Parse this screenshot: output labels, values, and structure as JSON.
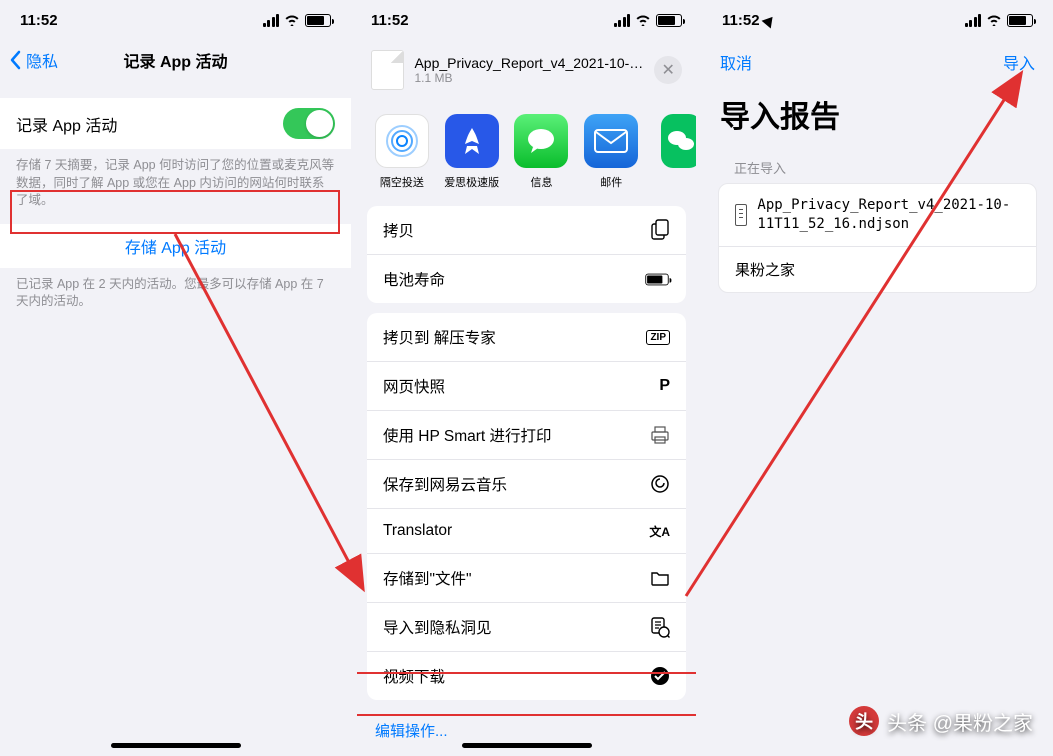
{
  "status": {
    "time": "11:52"
  },
  "screen1": {
    "back": "隐私",
    "title": "记录 App 活动",
    "toggle_label": "记录 App 活动",
    "desc1": "存储 7 天摘要，记录 App 何时访问了您的位置或麦克风等数据，同时了解 App 或您在 App 内访问的网站何时联系了域。",
    "store_btn": "存储 App 活动",
    "desc2": "已记录 App 在 2 天内的活动。您最多可以存储 App 在 7 天内的活动。"
  },
  "screen2": {
    "file_name": "App_Privacy_Report_v4_2021-10-11T11_...",
    "file_size": "1.1 MB",
    "apps": [
      {
        "label": "隔空投送",
        "bg": "#fff",
        "svg": "airdrop"
      },
      {
        "label": "爱思极速版",
        "bg": "#2858e8",
        "svg": "aisi"
      },
      {
        "label": "信息",
        "bg": "#30d158",
        "svg": "msg"
      },
      {
        "label": "邮件",
        "bg": "#1f6fde",
        "svg": "mail"
      },
      {
        "label": "",
        "bg": "#07c160",
        "svg": "wechat"
      }
    ],
    "actions1": [
      {
        "label": "拷贝",
        "icon": "copy"
      },
      {
        "label": "电池寿命",
        "icon": "battery"
      }
    ],
    "actions2": [
      {
        "label": "拷贝到 解压专家",
        "icon": "zip"
      },
      {
        "label": "网页快照",
        "icon": "p"
      },
      {
        "label": "使用 HP Smart 进行打印",
        "icon": "printer"
      },
      {
        "label": "保存到网易云音乐",
        "icon": "netease"
      },
      {
        "label": "Translator",
        "icon": "translate"
      },
      {
        "label": "存储到\"文件\"",
        "icon": "folder"
      },
      {
        "label": "导入到隐私洞见",
        "icon": "privacy"
      },
      {
        "label": "视频下载",
        "icon": "check"
      }
    ],
    "edit": "编辑操作..."
  },
  "screen3": {
    "cancel": "取消",
    "import": "导入",
    "title": "导入报告",
    "section": "正在导入",
    "filename": "App_Privacy_Report_v4_2021-10-11T11_52_16.ndjson",
    "source": "果粉之家"
  },
  "watermark": "头条 @果粉之家"
}
